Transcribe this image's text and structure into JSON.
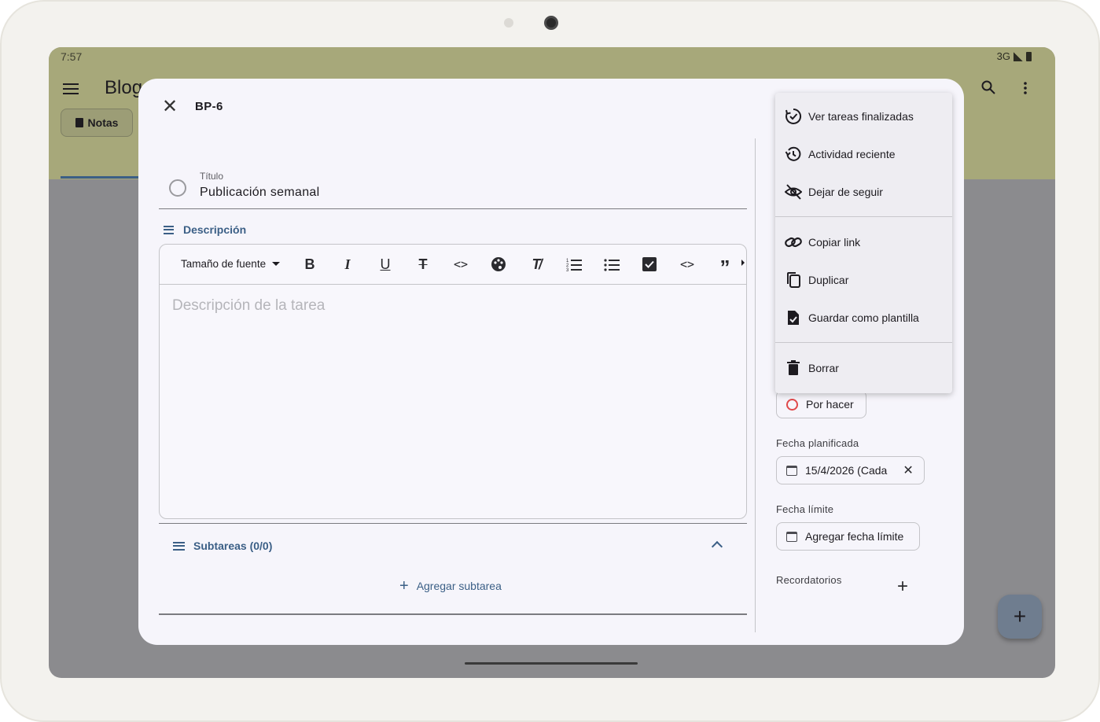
{
  "status_bar": {
    "time": "7:57",
    "network": "3G"
  },
  "app_bar": {
    "title": "Blog",
    "chip_label": "Notas",
    "fab_label": "+"
  },
  "dialog": {
    "task_id": "BP-6",
    "title": {
      "label": "Título",
      "value": "Publicación semanal"
    },
    "description": {
      "heading": "Descripción",
      "placeholder": "Descripción de la tarea",
      "toolbar": {
        "font_size_label": "Tamaño de fuente",
        "buttons": [
          "bold",
          "italic",
          "underline",
          "strikethrough",
          "inline-code",
          "text-color",
          "clear-format",
          "numbered-list",
          "bulleted-list",
          "checklist",
          "code-block",
          "quote"
        ]
      }
    },
    "subtasks": {
      "heading": "Subtareas (0/0)",
      "add_label": "Agregar subtarea"
    },
    "side": {
      "status": "Por hacer",
      "planned_date_label": "Fecha planificada",
      "planned_date_value": "15/4/2026 (Cada",
      "due_date_label": "Fecha límite",
      "due_date_button": "Agregar fecha límite",
      "reminders_label": "Recordatorios"
    },
    "menu": {
      "items": [
        {
          "label": "Ver tareas finalizadas",
          "icon": "task-done-icon"
        },
        {
          "label": "Actividad reciente",
          "icon": "history-icon"
        },
        {
          "label": "Dejar de seguir",
          "icon": "eye-off-icon"
        },
        {
          "label": "Copiar link",
          "icon": "link-icon"
        },
        {
          "label": "Duplicar",
          "icon": "copy-icon"
        },
        {
          "label": "Guardar como plantilla",
          "icon": "file-check-icon"
        },
        {
          "label": "Borrar",
          "icon": "trash-icon"
        }
      ]
    }
  },
  "colors": {
    "accent": "#3b5f86",
    "status_todo": "#e0494b",
    "app_bar": "#a7a87a"
  }
}
